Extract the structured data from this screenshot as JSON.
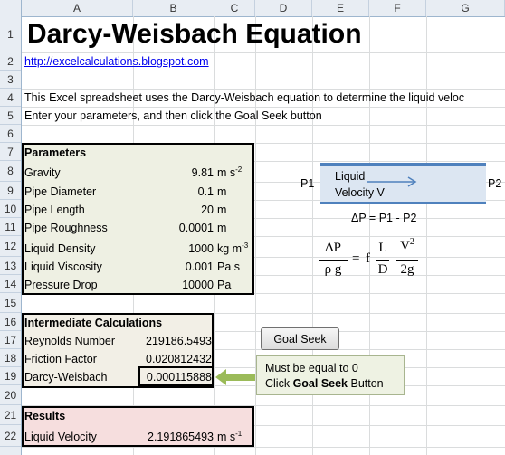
{
  "columns": [
    "A",
    "B",
    "C",
    "D",
    "E",
    "F",
    "G"
  ],
  "rows": [
    "1",
    "2",
    "3",
    "4",
    "5",
    "6",
    "7",
    "8",
    "9",
    "10",
    "11",
    "12",
    "13",
    "14",
    "15",
    "16",
    "17",
    "18",
    "19",
    "20",
    "21",
    "22"
  ],
  "title": "Darcy-Weisbach Equation",
  "link": "http://excelcalculations.blogspot.com",
  "description_line1": "This Excel spreadsheet uses the Darcy-Weisbach equation to determine the liquid veloc",
  "description_line2": "Enter your parameters, and then click the Goal Seek button",
  "parameters": {
    "header": "Parameters",
    "items": [
      {
        "label": "Gravity",
        "value": "9.81",
        "unit": "m s",
        "sup": "-2"
      },
      {
        "label": "Pipe Diameter",
        "value": "0.1",
        "unit": "m",
        "sup": ""
      },
      {
        "label": "Pipe Length",
        "value": "20",
        "unit": "m",
        "sup": ""
      },
      {
        "label": "Pipe Roughness",
        "value": "0.0001",
        "unit": "m",
        "sup": ""
      },
      {
        "label": "Liquid Density",
        "value": "1000",
        "unit": "kg m",
        "sup": "-3"
      },
      {
        "label": "Liquid Viscosity",
        "value": "0.001",
        "unit": "Pa s",
        "sup": ""
      },
      {
        "label": "Pressure Drop",
        "value": "10000",
        "unit": "Pa",
        "sup": ""
      }
    ]
  },
  "intermediate": {
    "header": "Intermediate Calculations",
    "items": [
      {
        "label": "Reynolds Number",
        "value": "219186.5493"
      },
      {
        "label": "Friction Factor",
        "value": "0.020812432"
      },
      {
        "label": "Darcy-Weisbach",
        "value": "0.000115888"
      }
    ]
  },
  "results": {
    "header": "Results",
    "label": "Liquid Velocity",
    "value": "2.191865493",
    "unit": "m s",
    "sup": "-1"
  },
  "diagram": {
    "p1": "P1",
    "p2": "P2",
    "liquid": "Liquid",
    "velocity": "Velocity V",
    "delta_p": "ΔP = P1 - P2"
  },
  "formula": {
    "num_left": "ΔP",
    "den_left": "ρ g",
    "eq": "=",
    "f": "f",
    "num_mid": "L",
    "den_mid": "D",
    "num_right": "V",
    "num_right_sup": "2",
    "den_right": "2g"
  },
  "goal_seek_button": "Goal Seek",
  "callout": {
    "line1": "Must be equal to 0",
    "line2_pre": "Click ",
    "line2_bold": "Goal Seek",
    "line2_post": " Button"
  },
  "colors": {
    "params_bg": "#eef0e3",
    "intermediate_bg": "#f2efe6",
    "results_bg": "#f6dede",
    "arrow": "#9bbb59",
    "pipe_fill": "#dce6f2",
    "pipe_border": "#4f81bd",
    "link": "#0000ee"
  }
}
